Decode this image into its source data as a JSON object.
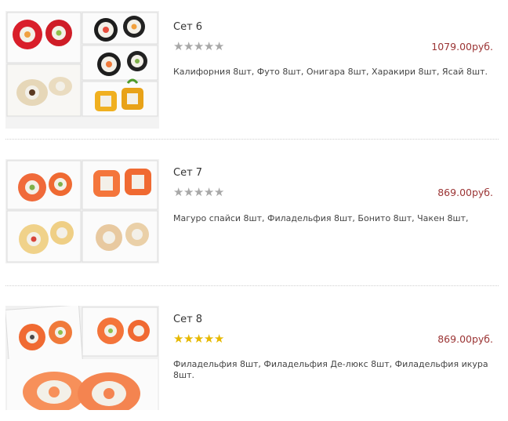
{
  "products": [
    {
      "title": "Сет 6",
      "price": "1079.00руб.",
      "description": "Калифорния 8шт, Футо 8шт, Онигара 8шт, Харакири 8шт, Ясай 8шт.",
      "rating": 0,
      "rating_max": 5
    },
    {
      "title": "Сет 7",
      "price": "869.00руб.",
      "description": "Магуро спайси 8шт, Филадельфия 8шт, Бонито 8шт, Чакен 8шт,",
      "rating": 0,
      "rating_max": 5
    },
    {
      "title": "Сет 8",
      "price": "869.00руб.",
      "description": "Филадельфия 8шт, Филадельфия Де-люкс 8шт, Филадельфия икура 8шт.",
      "rating": 5,
      "rating_max": 5
    }
  ],
  "colors": {
    "price": "#9b3434",
    "star_filled": "#e6b800",
    "star_empty": "#a8a8a8",
    "divider": "#cfcfcf"
  }
}
